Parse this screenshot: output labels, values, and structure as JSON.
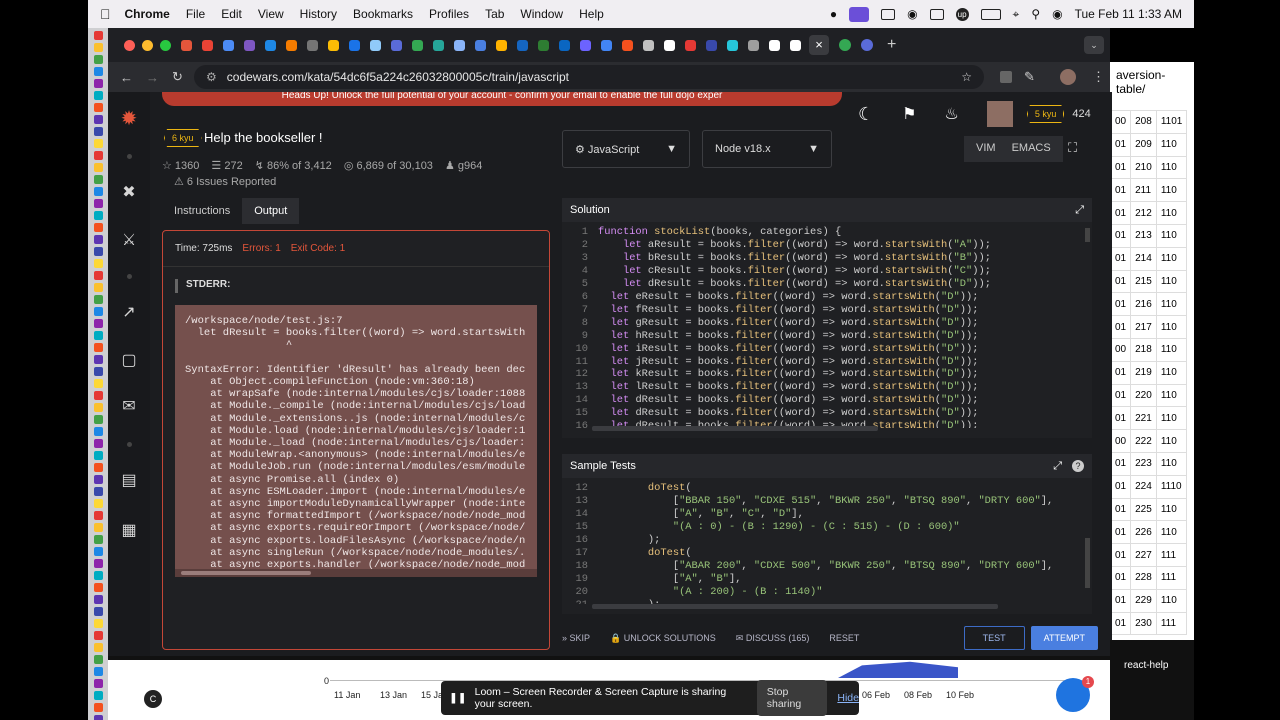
{
  "menubar": {
    "app": "Chrome",
    "items": [
      "File",
      "Edit",
      "View",
      "History",
      "Bookmarks",
      "Profiles",
      "Tab",
      "Window",
      "Help"
    ],
    "clock": "Tue Feb 11  1:33 AM"
  },
  "browser": {
    "url": "codewars.com/kata/54dc6f5a224c26032800005c/train/javascript",
    "side_tab_text": "aversion-table/"
  },
  "banner": {
    "text": "Heads Up!     Unlock the full potential of your account - confirm your email to enable the full dojo exper"
  },
  "kata": {
    "rank": "6 kyu",
    "title": "Help the bookseller !",
    "stars": "1360",
    "collections": "272",
    "satisfaction": "86% of 3,412",
    "completed": "6,869 of 30,103",
    "author": "g964",
    "issues": "6 Issues Reported"
  },
  "tabs": {
    "instructions": "Instructions",
    "output": "Output"
  },
  "output": {
    "time": "Time: 725ms",
    "errors": "Errors: 1",
    "exit": "Exit Code: 1",
    "stderr_label": "STDERR:",
    "trace": "/workspace/node/test.js:7\n  let dResult = books.filter((word) => word.startsWith\n                ^\n\nSyntaxError: Identifier 'dResult' has already been dec\n    at Object.compileFunction (node:vm:360:18)\n    at wrapSafe (node:internal/modules/cjs/loader:1088\n    at Module._compile (node:internal/modules/cjs/load\n    at Module._extensions..js (node:internal/modules/c\n    at Module.load (node:internal/modules/cjs/loader:1\n    at Module._load (node:internal/modules/cjs/loader:\n    at ModuleWrap.<anonymous> (node:internal/modules/e\n    at ModuleJob.run (node:internal/modules/esm/module\n    at async Promise.all (index 0)\n    at async ESMLoader.import (node:internal/modules/e\n    at async importModuleDynamicallyWrapper (node:inte\n    at async formattedImport (/workspace/node/node_mod\n    at async exports.requireOrImport (/workspace/node/\n    at async exports.loadFilesAsync (/workspace/node/n\n    at async singleRun (/workspace/node/node_modules/.\n    at async exports.handler (/workspace/node/node_mod"
  },
  "selects": {
    "language": "JavaScript",
    "version": "Node v18.x"
  },
  "modes": {
    "vim": "VIM",
    "emacs": "EMACS"
  },
  "user": {
    "rank": "5 kyu",
    "honor": "424"
  },
  "solution": {
    "title": "Solution",
    "lines": [
      "function stockList(books, categories) {",
      "    let aResult = books.filter((word) => word.startsWith(\"A\"));",
      "    let bResult = books.filter((word) => word.startsWith(\"B\"));",
      "    let cResult = books.filter((word) => word.startsWith(\"C\"));",
      "    let dResult = books.filter((word) => word.startsWith(\"D\"));",
      "  let eResult = books.filter((word) => word.startsWith(\"D\"));",
      "  let fResult = books.filter((word) => word.startsWith(\"D\"));",
      "  let gResult = books.filter((word) => word.startsWith(\"D\"));",
      "  let hResult = books.filter((word) => word.startsWith(\"D\"));",
      "  let iResult = books.filter((word) => word.startsWith(\"D\"));",
      "  let jResult = books.filter((word) => word.startsWith(\"D\"));",
      "  let kResult = books.filter((word) => word.startsWith(\"D\"));",
      "  let lResult = books.filter((word) => word.startsWith(\"D\"));",
      "  let dResult = books.filter((word) => word.startsWith(\"D\"));",
      "  let dResult = books.filter((word) => word.startsWith(\"D\"));",
      "  let dResult = books.filter((word) => word.startsWith(\"D\"));"
    ]
  },
  "tests": {
    "title": "Sample Tests",
    "start": 12,
    "lines": [
      "        doTest(",
      "            [\"BBAR 150\", \"CDXE 515\", \"BKWR 250\", \"BTSQ 890\", \"DRTY 600\"],",
      "            [\"A\", \"B\", \"C\", \"D\"],",
      "            \"(A : 0) - (B : 1290) - (C : 515) - (D : 600)\"",
      "        );",
      "        doTest(",
      "            [\"ABAR 200\", \"CDXE 500\", \"BKWR 250\", \"BTSQ 890\", \"DRTY 600\"],",
      "            [\"A\", \"B\"],",
      "            \"(A : 200) - (B : 1140)\"",
      "        );"
    ]
  },
  "actions": {
    "skip": "SKIP",
    "unlock": "UNLOCK SOLUTIONS",
    "discuss": "DISCUSS (165)",
    "reset": "RESET",
    "test": "TEST",
    "attempt": "ATTEMPT"
  },
  "strip": {
    "a": [
      "00",
      "01",
      "01",
      "01",
      "01",
      "01",
      "01",
      "01",
      "01",
      "01",
      "00",
      "01",
      "01",
      "01",
      "00",
      "01",
      "01",
      "01",
      "01",
      "01",
      "01"
    ],
    "b": [
      "208",
      "209",
      "210",
      "211",
      "212",
      "213",
      "214",
      "215",
      "216",
      "217",
      "218",
      "219",
      "220",
      "221",
      "222",
      "223",
      "224",
      "225",
      "226",
      "227",
      "228",
      "229",
      "230"
    ],
    "c": [
      "1101",
      "110",
      "110",
      "110",
      "110",
      "110",
      "110",
      "110",
      "110",
      "110",
      "110",
      "110",
      "110",
      "110",
      "110",
      "110",
      "1110",
      "110",
      "110",
      "111",
      "111",
      "110",
      "111"
    ]
  },
  "chart": {
    "dates": [
      "0",
      "11 Jan",
      "13 Jan",
      "15 Jan",
      "06 Feb",
      "08 Feb",
      "10 Feb"
    ]
  },
  "loom": {
    "text": "Loom – Screen Recorder & Screen Capture is sharing your screen.",
    "stop": "Stop sharing",
    "hide": "Hide"
  },
  "chat": {
    "label": "react-help",
    "badge": "1"
  }
}
